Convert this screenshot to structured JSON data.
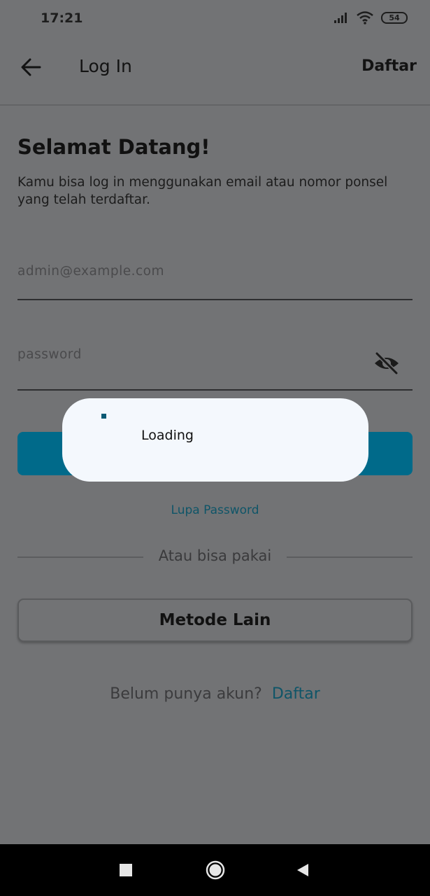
{
  "status_bar": {
    "time": "17:21",
    "battery": "54",
    "icons": [
      "signal-icon",
      "wifi-icon",
      "battery-icon"
    ]
  },
  "app_bar": {
    "back_icon": "arrow-left-icon",
    "title": "Log In",
    "register_label": "Daftar"
  },
  "welcome": {
    "title": "Selamat Datang!",
    "subtitle": "Kamu bisa log in menggunakan email atau nomor ponsel yang telah terdaftar."
  },
  "form": {
    "email_placeholder": "admin@example.com",
    "email_value": "",
    "password_placeholder": "password",
    "password_value": "",
    "visibility_icon": "eye-off-icon"
  },
  "links": {
    "forgot_password": "Lupa Password",
    "divider_text": "Atau bisa pakai",
    "other_method": "Metode Lain",
    "signup_question": "Belum punya akun?",
    "signup_link": "Daftar"
  },
  "dialog": {
    "loading_text": "Loading"
  },
  "colors": {
    "accent": "#006a8a",
    "link": "#0f5568",
    "overlay_background": "#727375",
    "dialog_background": "#f4f8fd"
  },
  "nav_bar": {
    "icons": [
      "recent-apps-icon",
      "home-icon",
      "back-icon"
    ]
  }
}
